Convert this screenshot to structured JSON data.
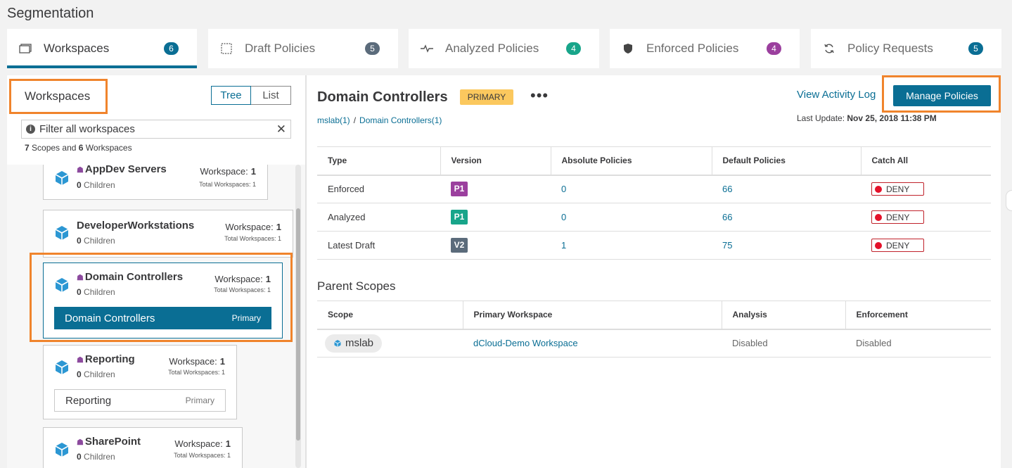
{
  "page": {
    "title": "Segmentation"
  },
  "tabs": [
    {
      "label": "Workspaces",
      "count": "6",
      "icon": "workspaces-icon",
      "color": "#0a6e94",
      "active": true
    },
    {
      "label": "Draft Policies",
      "count": "5",
      "icon": "draft-icon",
      "color": "#5b6b7b"
    },
    {
      "label": "Analyzed Policies",
      "count": "4",
      "icon": "pulse-icon",
      "color": "#18a58a"
    },
    {
      "label": "Enforced Policies",
      "count": "4",
      "icon": "shield-icon",
      "color": "#9b3f9e"
    },
    {
      "label": "Policy Requests",
      "count": "5",
      "icon": "refresh-icon",
      "color": "#0a6e94"
    }
  ],
  "sidebar": {
    "title": "Workspaces",
    "view_tree": "Tree",
    "view_list": "List",
    "filter_placeholder": "Filter all workspaces",
    "summary": {
      "scopes": "7",
      "scopes_label": "Scopes and",
      "workspaces": "6",
      "workspaces_label": "Workspaces"
    },
    "cards": [
      {
        "name": "AppDev Servers",
        "home": true,
        "children": "0",
        "children_label": "Children",
        "ws_label": "Workspace:",
        "ws": "1",
        "total": "Total Workspaces: 1"
      },
      {
        "name": "DeveloperWorkstations",
        "home": false,
        "children": "0",
        "children_label": "Children",
        "ws_label": "Workspace:",
        "ws": "1",
        "total": "Total Workspaces: 1"
      },
      {
        "name": "Domain Controllers",
        "home": true,
        "children": "0",
        "children_label": "Children",
        "ws_label": "Workspace:",
        "ws": "1",
        "total": "Total Workspaces: 1",
        "bar_name": "Domain Controllers",
        "bar_tag": "Primary"
      },
      {
        "name": "Reporting",
        "home": true,
        "children": "0",
        "children_label": "Children",
        "ws_label": "Workspace:",
        "ws": "1",
        "total": "Total Workspaces: 1",
        "bar_name": "Reporting",
        "bar_tag": "Primary"
      },
      {
        "name": "SharePoint",
        "home": true,
        "children": "0",
        "children_label": "Children",
        "ws_label": "Workspace:",
        "ws": "1",
        "total": "Total Workspaces: 1"
      }
    ]
  },
  "detail": {
    "title": "Domain Controllers",
    "badge": "PRIMARY",
    "more": "•••",
    "breadcrumb": [
      "mslab(1)",
      "Domain Controllers(1)"
    ],
    "activity_link": "View Activity Log",
    "manage_button": "Manage Policies",
    "last_update_label": "Last Update:",
    "last_update_value": "Nov 25, 2018 11:38 PM",
    "policy_table": {
      "headers": [
        "Type",
        "Version",
        "Absolute Policies",
        "Default Policies",
        "Catch All"
      ],
      "rows": [
        {
          "type": "Enforced",
          "version": "P1",
          "version_color": "#9b3f9e",
          "absolute": "0",
          "default": "66",
          "catch_all": "DENY"
        },
        {
          "type": "Analyzed",
          "version": "P1",
          "version_color": "#18a58a",
          "absolute": "0",
          "default": "66",
          "catch_all": "DENY"
        },
        {
          "type": "Latest Draft",
          "version": "V2",
          "version_color": "#5b6b7b",
          "absolute": "1",
          "default": "75",
          "catch_all": "DENY"
        }
      ]
    },
    "parent_scopes": {
      "title": "Parent Scopes",
      "headers": [
        "Scope",
        "Primary Workspace",
        "Analysis",
        "Enforcement"
      ],
      "rows": [
        {
          "scope": "mslab",
          "workspace": "dCloud-Demo Workspace",
          "analysis": "Disabled",
          "enforcement": "Disabled"
        }
      ]
    }
  },
  "colors": {
    "accent": "#0a6e94",
    "highlight": "#f0842c",
    "badge": "#fbc85e",
    "deny": "#e4112a"
  }
}
